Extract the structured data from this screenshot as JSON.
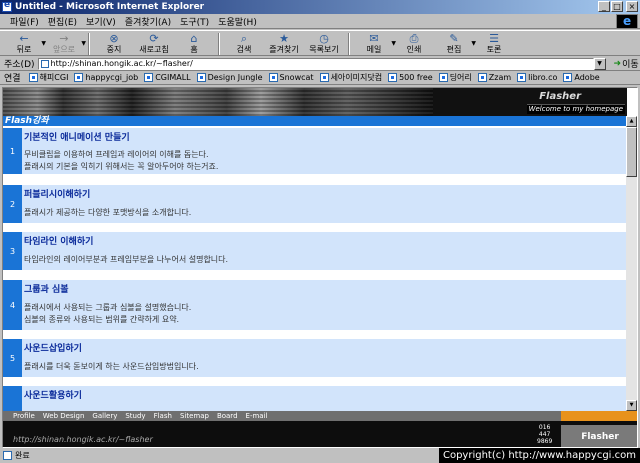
{
  "window": {
    "title": "Untitled - Microsoft Internet Explorer",
    "buttons": [
      "_",
      "□",
      "×"
    ]
  },
  "menu": [
    "파일(F)",
    "편집(E)",
    "보기(V)",
    "즐겨찾기(A)",
    "도구(T)",
    "도움말(H)"
  ],
  "toolbar": [
    {
      "label": "뒤로",
      "icon": "←",
      "disabled": false,
      "dropdown": true
    },
    {
      "label": "앞으로",
      "icon": "→",
      "disabled": true,
      "dropdown": true
    },
    {
      "label": "중지",
      "icon": "⊗",
      "disabled": false
    },
    {
      "label": "새로고침",
      "icon": "⟳",
      "disabled": false
    },
    {
      "label": "홈",
      "icon": "⌂",
      "disabled": false
    },
    {
      "label": "검색",
      "icon": "⌕",
      "disabled": false
    },
    {
      "label": "즐겨찾기",
      "icon": "★",
      "disabled": false
    },
    {
      "label": "목록보기",
      "icon": "◷",
      "disabled": false
    },
    {
      "label": "메일",
      "icon": "✉",
      "disabled": false,
      "dropdown": true
    },
    {
      "label": "인쇄",
      "icon": "⎙",
      "disabled": false
    },
    {
      "label": "편집",
      "icon": "✎",
      "disabled": false,
      "dropdown": true
    },
    {
      "label": "토론",
      "icon": "☰",
      "disabled": false
    }
  ],
  "address": {
    "label": "주소(D)",
    "value": "http://shinan.hongik.ac.kr/~flasher/",
    "go_label": "이동"
  },
  "links": {
    "label": "연결",
    "items": [
      "해피CGI",
      "happycgi_job",
      "CGIMALL",
      "Design Jungle",
      "Snowcat",
      "세아이미지닷컴",
      "500 free",
      "딩어리",
      "Zzam",
      "libro.co",
      "Adobe"
    ]
  },
  "page": {
    "brand": "Flasher",
    "tagline": "Welcome to my homepage",
    "section_title": "Flash강좌",
    "courses": [
      {
        "num": "1",
        "title": "기본적인 애니메이션 만들기",
        "desc": [
          "무비클립을 이용하여 프레임과 레이어의 이해를 돕는다.",
          "플래시의 기본을 익히기 위해서는 꼭 알아두어야 하는거죠."
        ]
      },
      {
        "num": "2",
        "title": "퍼블리시이해하기",
        "desc": [
          "플래시가 제공하는 다양한 포맷방식을 소개합니다."
        ]
      },
      {
        "num": "3",
        "title": "타임라인 이해하기",
        "desc": [
          "타임라인의 레이어부분과 프레임부분을 나누어서 설명합니다."
        ]
      },
      {
        "num": "4",
        "title": "그룹과 심볼",
        "desc": [
          "플래시에서 사용되는 그룹과 심볼을 설명했습니다.",
          "심볼의 종류와 사용되는 범위를 간략하게 요약."
        ]
      },
      {
        "num": "5",
        "title": "사운드삽입하기",
        "desc": [
          "플래시를 더욱 돋보이게 하는 사운드삽입방법입니다."
        ]
      },
      {
        "num": "",
        "title": "사운드활용하기",
        "desc": []
      }
    ],
    "nav": [
      "Profile",
      "Web Design",
      "Gallery",
      "Study",
      "Flash",
      "Sitemap",
      "Board",
      "E-mail"
    ],
    "footer_url": "http://shinan.hongik.ac.kr/~flasher",
    "footer_phone": [
      "016",
      "447",
      "9869"
    ],
    "footer_brand": "Flasher"
  },
  "status": {
    "text": "완료",
    "copyright": "Copyright(c) http://www.happycgi.com"
  }
}
